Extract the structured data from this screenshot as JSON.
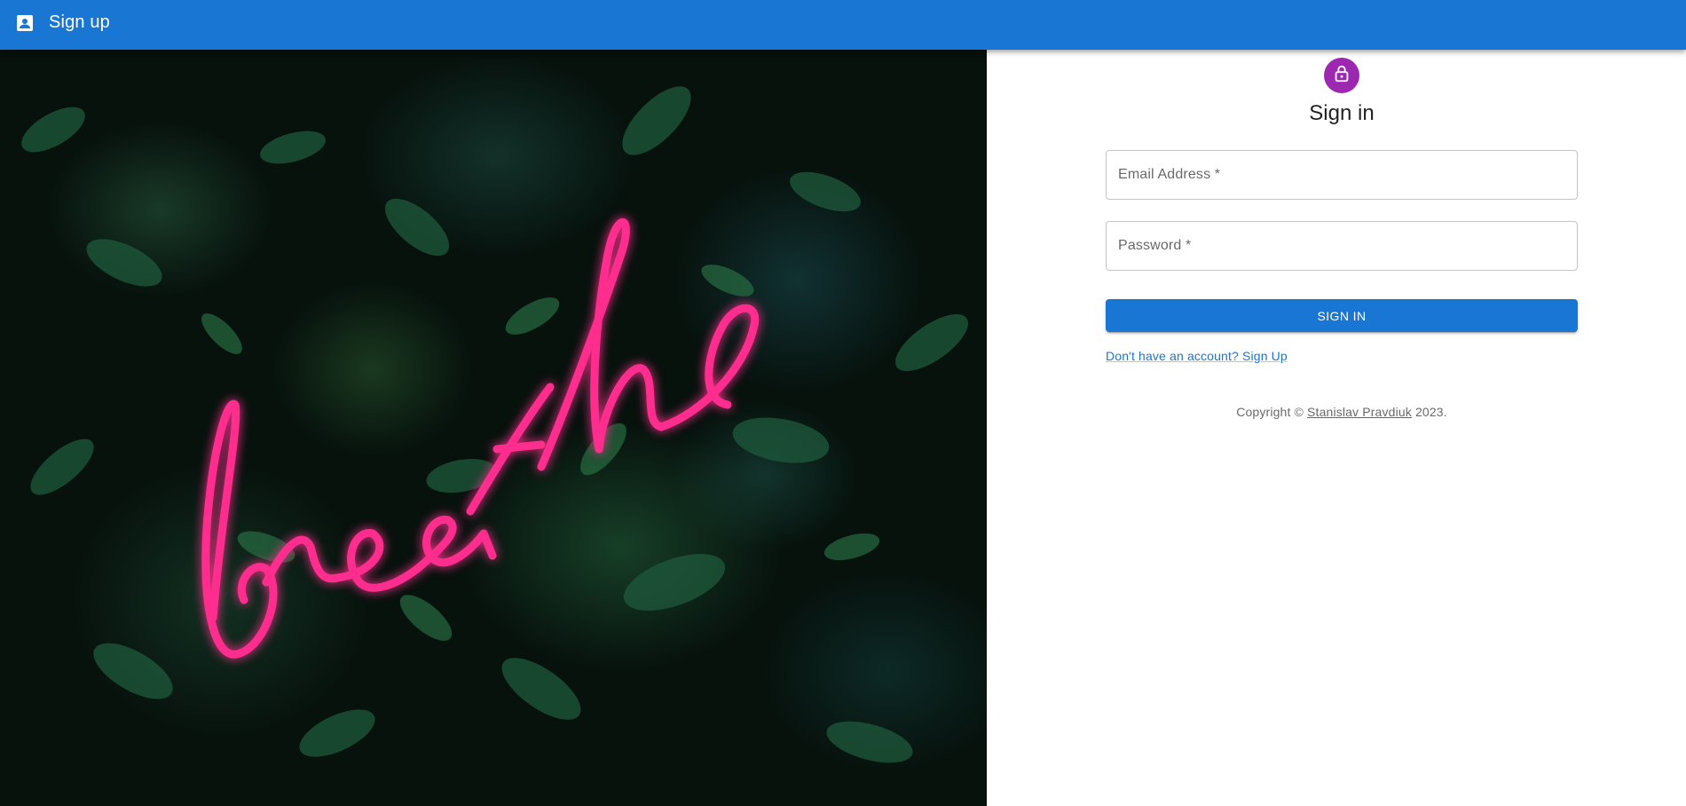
{
  "appbar": {
    "icon": "account-box-icon",
    "title": "Sign up",
    "color": "#1976d2"
  },
  "hero": {
    "neon_text": "breathe",
    "neon_color": "#ff2f8e"
  },
  "form": {
    "avatar_icon": "lock-icon",
    "avatar_color": "#9c27b0",
    "heading": "Sign in",
    "email_label": "Email Address *",
    "email_value": "",
    "password_label": "Password *",
    "password_value": "",
    "submit_label": "Sign In",
    "signup_link": "Don't have an account? Sign Up"
  },
  "footer": {
    "copyright_prefix": "Copyright ©",
    "author": "Stanislav Pravdiuk",
    "year_suffix": "2023."
  }
}
